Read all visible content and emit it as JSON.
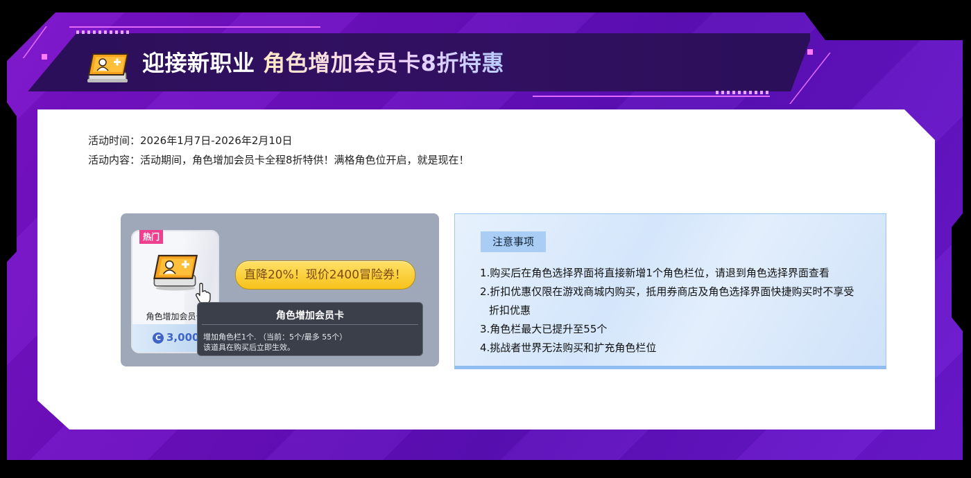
{
  "header": {
    "title_part1": "迎接新职业 ",
    "title_part2": "角色增加会员卡8折特惠"
  },
  "activity": {
    "time_label": "活动时间：",
    "time_value": "2026年1月7日-2026年2月10日",
    "content_label": "活动内容：",
    "content_value": "活动期间，角色增加会员卡全程8折特供！满格角色位开启，就是现在！"
  },
  "product": {
    "badge": "热门",
    "name": "角色增加会员卡",
    "price": "3,000",
    "coin_symbol": "C",
    "discount_button": "直降20%！现价2400冒险券！"
  },
  "tooltip": {
    "title": "角色增加会员卡",
    "line1": "增加角色栏1个. （当前：5个/最多 55个）",
    "line2": "该道具在购买后立即生效。"
  },
  "notes": {
    "tag": "注意事项",
    "items": [
      "1.购买后在角色选择界面将直接新增1个角色栏位，请退到角色选择界面查看",
      "2.折扣优惠仅限在游戏商城内购买，抵用券商店及角色选择界面快捷购买时不享受",
      "折扣优惠",
      "3.角色栏最大已提升至55个",
      "4.挑战者世界无法购买和扩充角色栏位"
    ]
  },
  "colors": {
    "frame_purple": "#6a0fbf",
    "header_band": "#2b0f5a",
    "neon": "#e16bff",
    "hot_badge": "#ef3f8f",
    "discount_yellow": "#f7c21b",
    "notes_tag": "#a9cdf5"
  },
  "icons": {
    "title_icon": "character-card-icon",
    "item_icon": "character-card-icon",
    "coin": "coin-icon",
    "cursor": "hand-pointer-icon"
  }
}
